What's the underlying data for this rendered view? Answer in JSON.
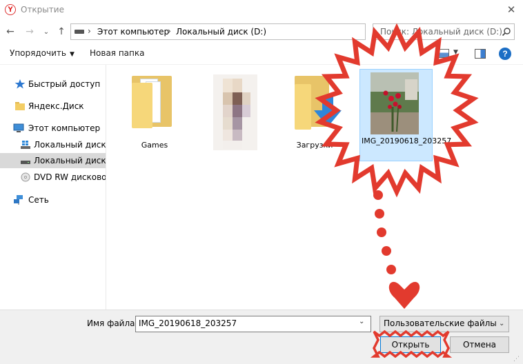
{
  "window": {
    "app_icon_glyph": "Y",
    "title": "Открытие",
    "close_glyph": "✕"
  },
  "nav": {
    "back_glyph": "←",
    "forward_glyph": "→",
    "history_glyph": "⌄",
    "up_glyph": "↑"
  },
  "address": {
    "crumbs": [
      "Этот компьютер",
      "Локальный диск (D:)"
    ],
    "separator": "›",
    "dropdown_glyph": "⌄",
    "refresh_glyph": "↻"
  },
  "search": {
    "placeholder": "Поиск: Локальный диск (D:)"
  },
  "toolbar": {
    "organize_label": "Упорядочить",
    "organize_caret": "▼",
    "new_folder_label": "Новая папка",
    "view_caret": "▼",
    "help_glyph": "?"
  },
  "sidebar": {
    "items": [
      {
        "label": "Быстрый доступ",
        "icon": "star-icon"
      },
      {
        "label": "Яндекс.Диск",
        "icon": "folder-icon"
      },
      {
        "label": "Этот компьютер",
        "icon": "computer-icon"
      },
      {
        "label": "Локальный диск (C",
        "icon": "windows-drive-icon"
      },
      {
        "label": "Локальный диск (D",
        "icon": "drive-icon",
        "selected": true
      },
      {
        "label": "DVD RW дисковод (",
        "icon": "dvd-icon"
      },
      {
        "label": "Сеть",
        "icon": "network-icon"
      }
    ]
  },
  "files": [
    {
      "name": "Games",
      "type": "folder-with-docs"
    },
    {
      "name": "",
      "type": "blurred-thumbnail"
    },
    {
      "name": "Загрузки",
      "type": "downloads-folder"
    },
    {
      "name": "IMG_20190618_203257",
      "type": "photo",
      "selected": true
    }
  ],
  "bottom": {
    "filename_label": "Имя файла:",
    "filename_value": "IMG_20190618_203257",
    "filename_dd_glyph": "⌄",
    "filetype_value": "Пользовательские файлы",
    "filetype_dd_glyph": "⌄",
    "open_label": "Открыть",
    "cancel_label": "Отмена",
    "grip_glyph": "⋰"
  },
  "colors": {
    "accent": "#0078d7",
    "selection": "#cce8ff",
    "annotation_red": "#e23a2e"
  }
}
